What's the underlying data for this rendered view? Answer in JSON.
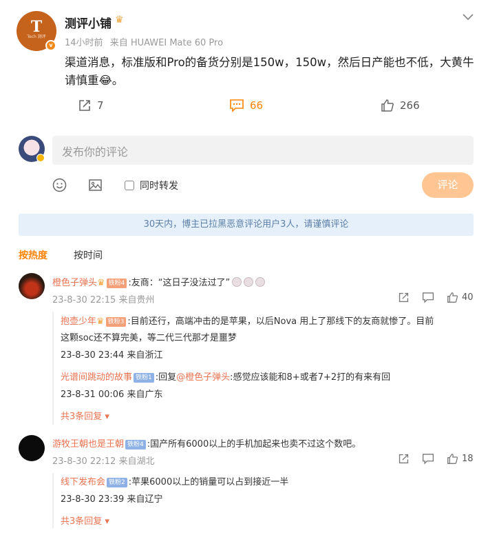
{
  "post": {
    "username": "测评小铺",
    "avatar_text": "T",
    "avatar_sub": "Tech 测评",
    "time": "14小时前",
    "source": "来自 HUAWEI Mate 60 Pro",
    "text_line1": "渠道消息，标准版和Pro的备货分别是150w，150w，然后日产能也不低，大黄牛",
    "text_line2": "请慎重😂。",
    "shares": "7",
    "comments": "66",
    "likes": "266"
  },
  "composer": {
    "placeholder": "发布你的评论",
    "repost_label": "同时转发",
    "submit_label": "评论"
  },
  "notice": "30天内，博主已拉黑恶意评论用户3人，请谨慎评论",
  "sort": {
    "hot": "按热度",
    "time": "按时间"
  },
  "comments": [
    {
      "name": "橙色子弹头",
      "badge": "铁粉4",
      "text": ":友商：“这日子没法过了”",
      "time": "23-8-30 22:15",
      "location": "来自贵州",
      "likes": "40",
      "replies": [
        {
          "name": "抱壶少年",
          "badge": "铁粉3",
          "text_line1": ":目前还行，高端冲击的是苹果，以后Nova 用上了那线下的友商就惨了。目前",
          "text_line2": "这颗soc还不算完美，等二代三代那才是噩梦",
          "time": "23-8-30 23:44",
          "location": "来自浙江"
        },
        {
          "name": "光谱间跳动的故事",
          "badge": "铁粉1",
          "reply_prefix": ":回复",
          "reply_to": "@橙色子弹头",
          "text": ":感觉应该能和8+或者7+2打的有来有回",
          "time": "23-8-31 00:06",
          "location": "来自广东"
        }
      ],
      "more": "共3条回复"
    },
    {
      "name": "游牧王朝也是王朝",
      "badge": "铁粉4",
      "text": ":国产所有6000以上的手机加起来也卖不过这个数吧。",
      "time": "23-8-30 22:12",
      "location": "来自湖北",
      "likes": "18",
      "replies": [
        {
          "name": "线下发布会",
          "badge": "铁粉2",
          "text": ":苹果6000以上的销量可以占到接近一半",
          "time": "23-8-30 23:39",
          "location": "来自辽宁"
        }
      ],
      "more": "共3条回复"
    }
  ]
}
